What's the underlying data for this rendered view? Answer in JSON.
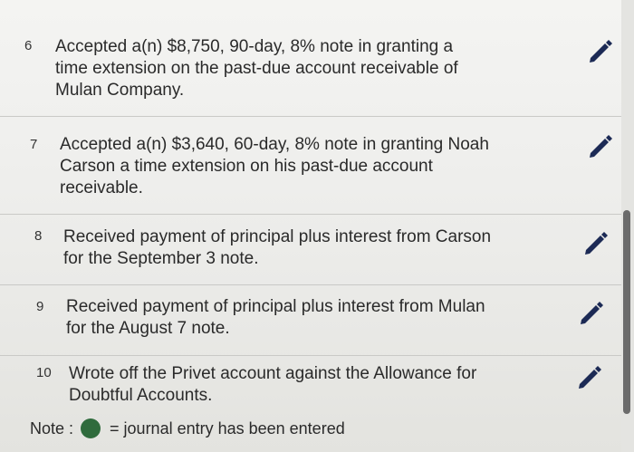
{
  "rows": [
    {
      "num": "6",
      "text": "Accepted a(n) $8,750, 90-day, 8% note in granting a\ntime extension on the past-due account receivable of\nMulan Company."
    },
    {
      "num": "7",
      "text": "Accepted a(n) $3,640, 60-day, 8% note in granting Noah\nCarson a time extension on his past-due account\nreceivable."
    },
    {
      "num": "8",
      "text": "Received payment of principal plus interest from Carson\nfor the September 3 note."
    },
    {
      "num": "9",
      "text": "Received payment of principal plus interest from Mulan\nfor the August 7 note."
    },
    {
      "num": "10",
      "text": "Wrote off the Privet account against the Allowance for\nDoubtful Accounts."
    }
  ],
  "note": {
    "label": "Note :",
    "text": "= journal entry has been entered",
    "dot_color": "#2f6b3c"
  },
  "icons": {
    "edit": "pencil-icon"
  }
}
